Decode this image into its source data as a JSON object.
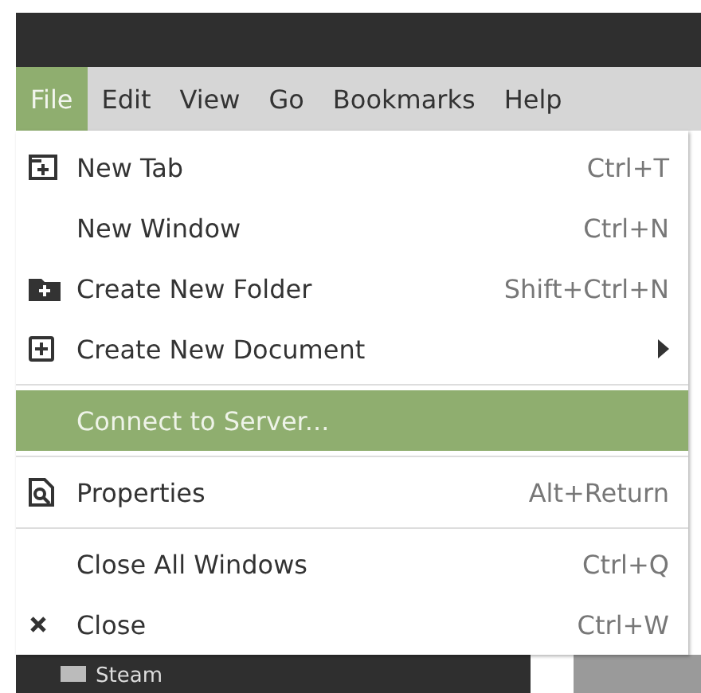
{
  "menubar": [
    {
      "label": "File",
      "selected": true
    },
    {
      "label": "Edit",
      "selected": false
    },
    {
      "label": "View",
      "selected": false
    },
    {
      "label": "Go",
      "selected": false
    },
    {
      "label": "Bookmarks",
      "selected": false
    },
    {
      "label": "Help",
      "selected": false
    }
  ],
  "menu": [
    {
      "kind": "item",
      "label": "New Tab",
      "shortcut": "Ctrl+T",
      "selected": false
    },
    {
      "kind": "item",
      "label": "New Window",
      "shortcut": "Ctrl+N",
      "selected": false
    },
    {
      "kind": "item",
      "label": "Create New Folder",
      "shortcut": "Shift+Ctrl+N",
      "selected": false
    },
    {
      "kind": "submenu",
      "label": "Create New Document",
      "selected": false
    },
    {
      "kind": "separator"
    },
    {
      "kind": "item",
      "label": "Connect to Server...",
      "selected": true
    },
    {
      "kind": "separator"
    },
    {
      "kind": "item",
      "label": "Properties",
      "shortcut": "Alt+Return",
      "selected": false
    },
    {
      "kind": "separator"
    },
    {
      "kind": "item",
      "label": "Close All Windows",
      "shortcut": "Ctrl+Q",
      "selected": false
    },
    {
      "kind": "item",
      "label": "Close",
      "shortcut": "Ctrl+W",
      "selected": false
    }
  ],
  "sidebar": {
    "item": "Steam"
  }
}
